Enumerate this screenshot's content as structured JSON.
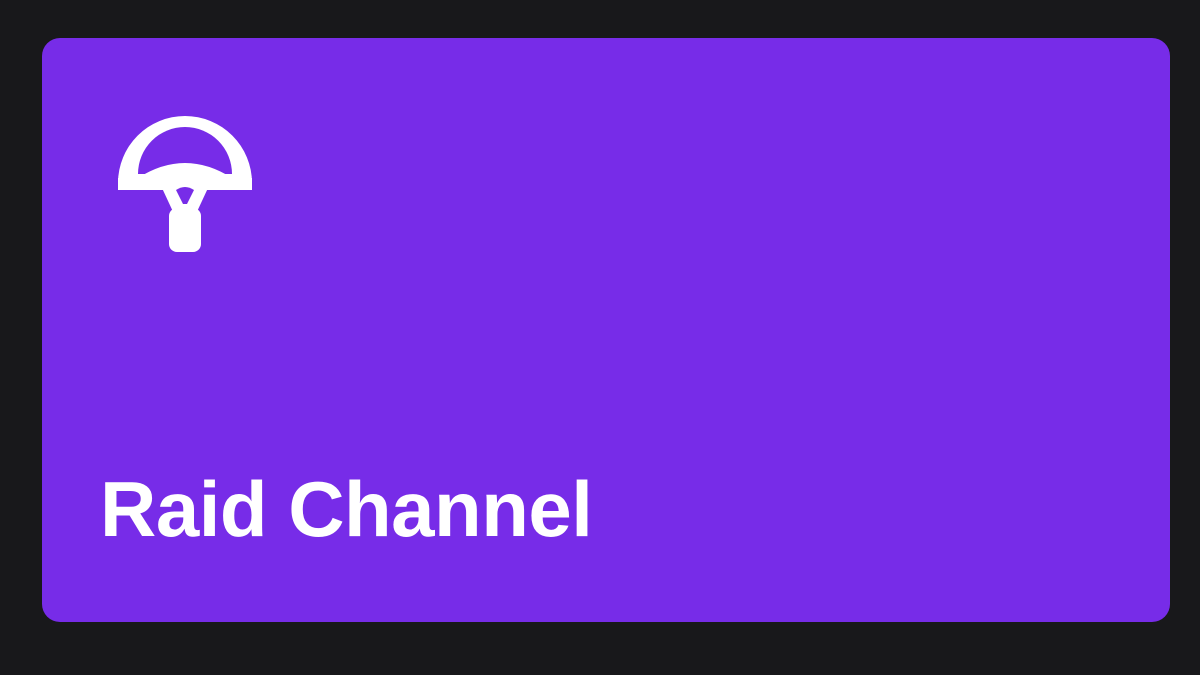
{
  "card": {
    "label": "Raid Channel",
    "icon": "parachute-icon",
    "background_color": "#772ce8",
    "text_color": "#ffffff"
  },
  "page": {
    "background_color": "#18181b"
  }
}
